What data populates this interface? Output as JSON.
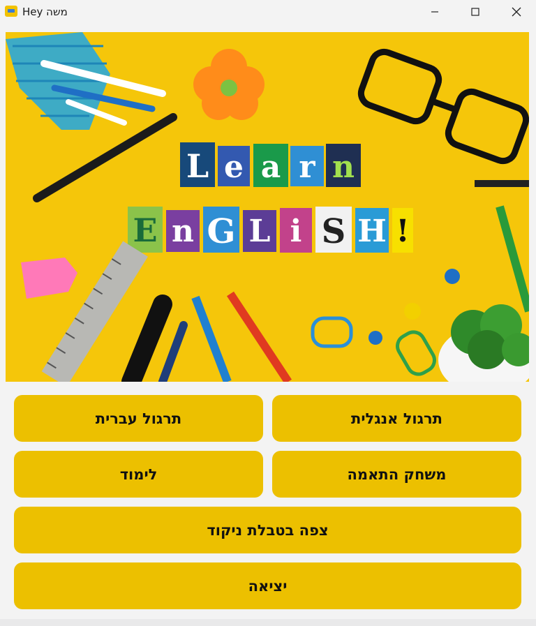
{
  "window": {
    "title": "Hey משה",
    "app_icon": "book-icon",
    "controls": [
      "minimize-icon",
      "maximize-icon",
      "close-icon"
    ]
  },
  "hero": {
    "word1": [
      "L",
      "e",
      "a",
      "r",
      "n"
    ],
    "word2": [
      "E",
      "n",
      "G",
      "L",
      "i",
      "S",
      "H",
      "!"
    ]
  },
  "buttons": {
    "english_practice": "תרגול אנגלית",
    "hebrew_practice": "תרגול עברית",
    "matching_game": "משחק התאמה",
    "study": "לימוד",
    "scoreboard": "צפה בטבלת ניקוד",
    "exit": "יציאה"
  },
  "colors": {
    "button_bg": "#ecc000",
    "hero_bg": "#f5c60a",
    "window_bg": "#f3f3f3"
  }
}
